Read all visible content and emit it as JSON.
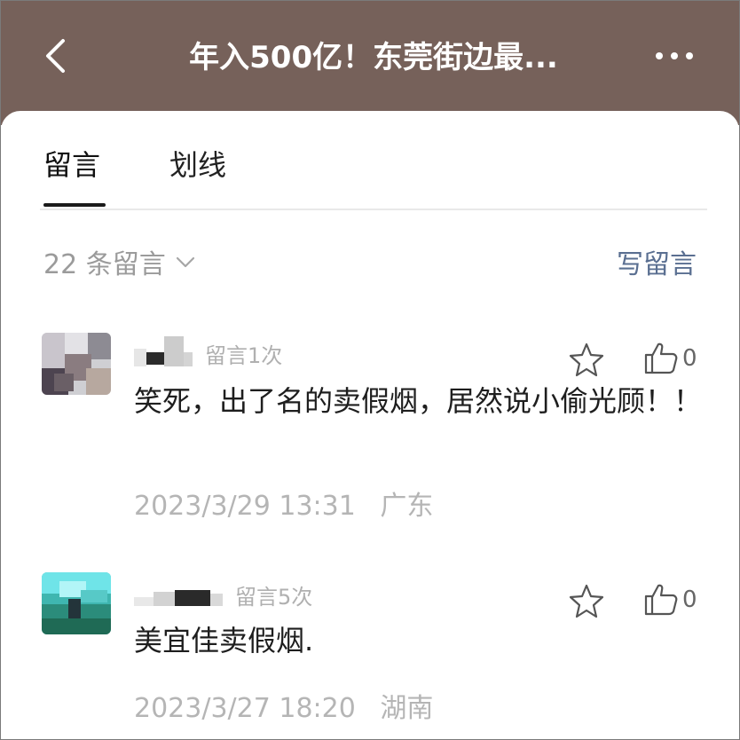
{
  "header": {
    "title": "年入500亿！东莞街边最...",
    "back_icon": "chevron-left-icon",
    "more_icon": "more-dots-icon"
  },
  "tabs": [
    {
      "label": "留言",
      "active": true
    },
    {
      "label": "划线",
      "active": false
    }
  ],
  "comments_bar": {
    "count_label": "22 条留言",
    "write_label": "写留言"
  },
  "comments": [
    {
      "meta": "留言1次",
      "text": "笑死，出了名的卖假烟，居然说小偷光顾！！",
      "date": "2023/3/29 13:31",
      "location": "广东",
      "likes": "0"
    },
    {
      "meta": "留言5次",
      "text": "美宜佳卖假烟.",
      "date": "2023/3/27 18:20",
      "location": "湖南",
      "likes": "0"
    }
  ],
  "colors": {
    "header_bg": "#76615a",
    "link": "#5a6f91"
  }
}
